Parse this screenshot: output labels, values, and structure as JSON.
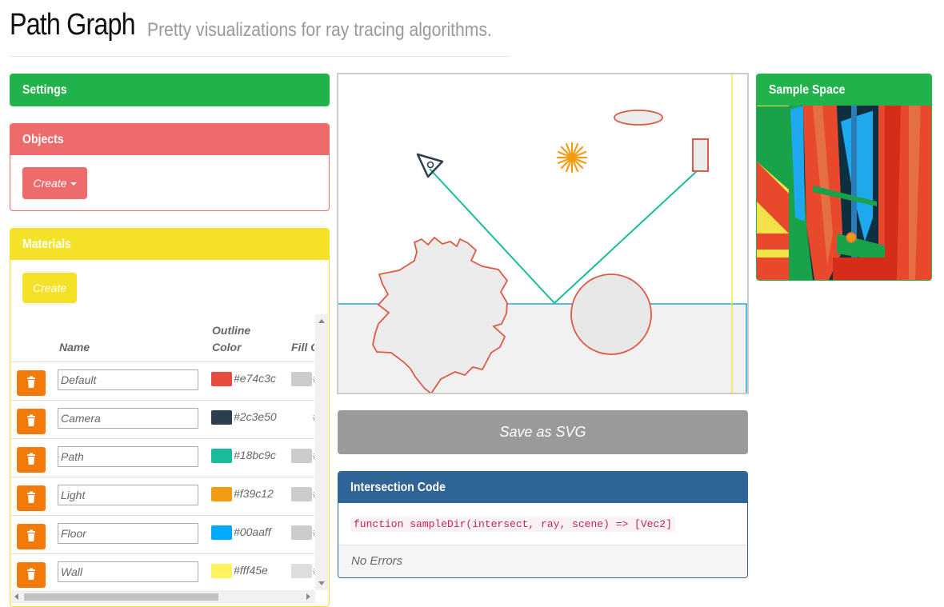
{
  "header": {
    "title": "Path Graph",
    "subtitle": "Pretty visualizations for ray tracing algorithms."
  },
  "settings": {
    "title": "Settings",
    "color": "#22b24c"
  },
  "objects": {
    "title": "Objects",
    "create_label": "Create",
    "color": "#ee6b6b"
  },
  "materials": {
    "title": "Materials",
    "create_label": "Create",
    "color": "#f5e128",
    "columns": {
      "name": "Name",
      "outline_line1": "Outline",
      "outline_line2": "Color",
      "fill": "Fill C"
    },
    "rows": [
      {
        "name": "Default",
        "outline": "#e74c3c",
        "hex": "#e74c3c",
        "fill": "#cccccc",
        "fill_text": "#"
      },
      {
        "name": "Camera",
        "outline": "#2c3e50",
        "hex": "#2c3e50",
        "fill": "",
        "fill_text": "#"
      },
      {
        "name": "Path",
        "outline": "#18bc9c",
        "hex": "#18bc9c",
        "fill": "#cccccc",
        "fill_text": "#"
      },
      {
        "name": "Light",
        "outline": "#f39c12",
        "hex": "#f39c12",
        "fill": "#cccccc",
        "fill_text": "#"
      },
      {
        "name": "Floor",
        "outline": "#00aaff",
        "hex": "#00aaff",
        "fill": "#cccccc",
        "fill_text": "#"
      },
      {
        "name": "Wall",
        "outline": "#fff45e",
        "hex": "#fff45e",
        "fill": "#dddddd",
        "fill_text": "#"
      }
    ]
  },
  "canvas": {
    "save_label": "Save as SVG"
  },
  "intersection": {
    "title": "Intersection Code",
    "code": "function sampleDir(intersect, ray, scene) => [Vec2]",
    "status": "No Errors",
    "color": "#2f6496"
  },
  "sample_space": {
    "title": "Sample Space",
    "color": "#22b24c"
  },
  "icons": {
    "trash": "trash-icon",
    "caret": "caret-down-icon",
    "camera": "camera-icon",
    "light": "sun-icon"
  }
}
